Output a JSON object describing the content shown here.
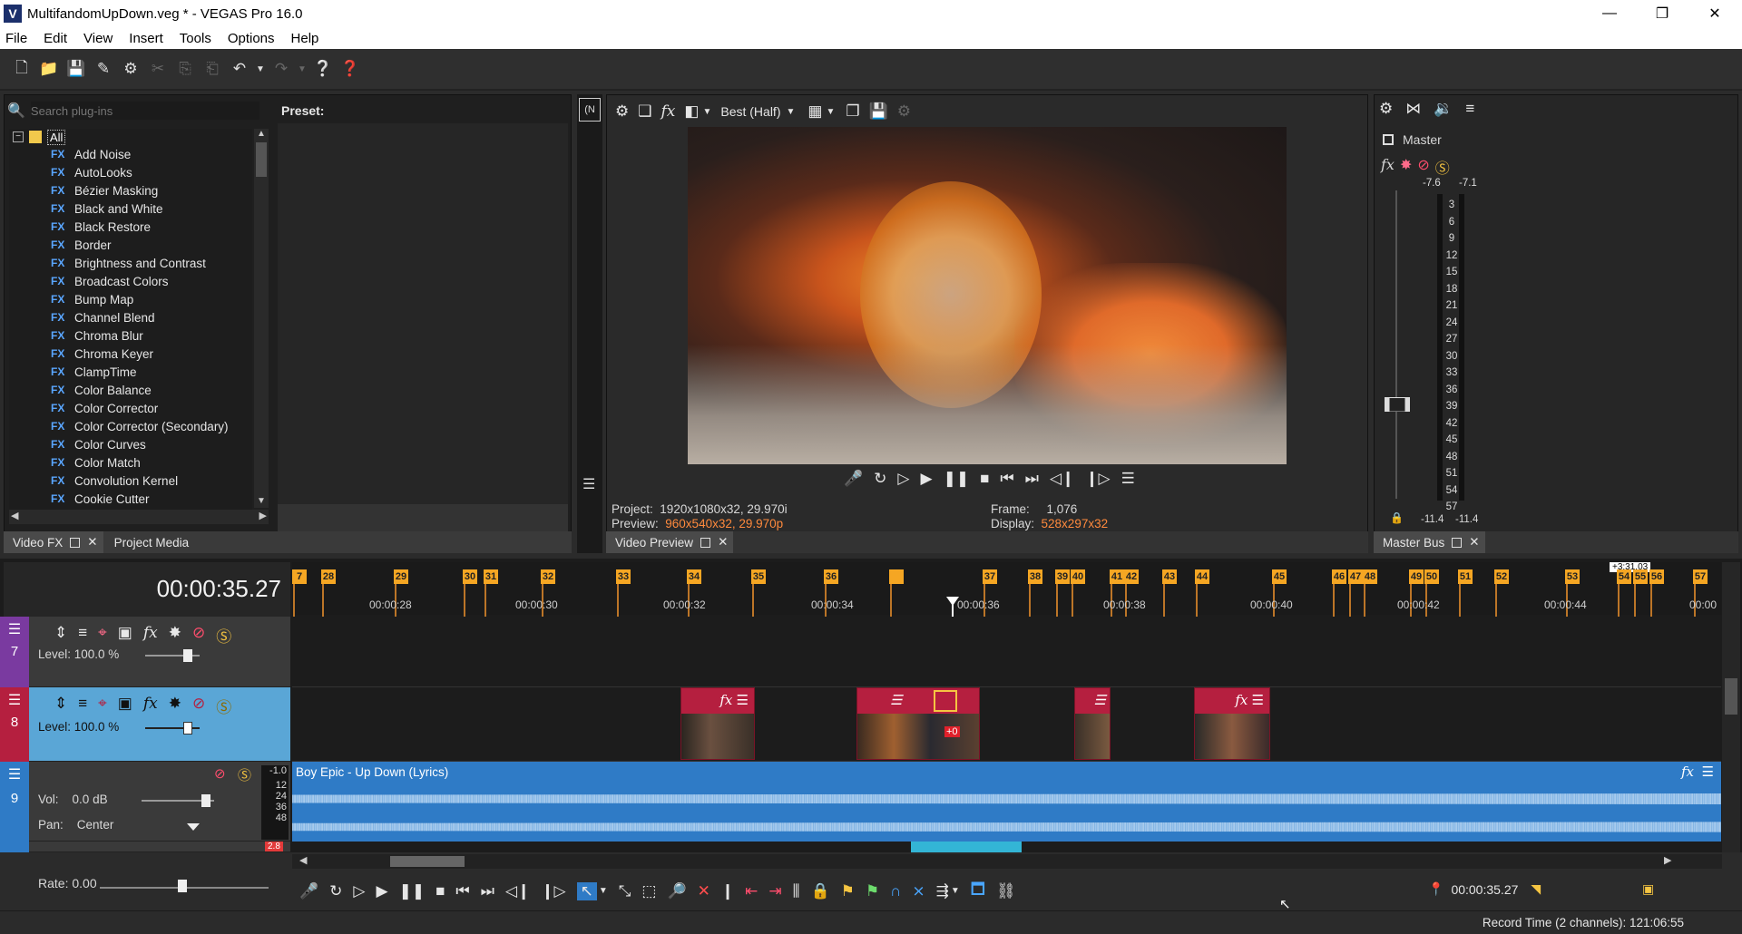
{
  "window": {
    "title": "MultifandomUpDown.veg * - VEGAS Pro 16.0",
    "app_icon": "V"
  },
  "menu": [
    "File",
    "Edit",
    "View",
    "Insert",
    "Tools",
    "Options",
    "Help"
  ],
  "plugins": {
    "search_placeholder": "Search plug-ins",
    "preset_label": "Preset:",
    "root": "All",
    "items": [
      "Add Noise",
      "AutoLooks",
      "Bézier Masking",
      "Black and White",
      "Black Restore",
      "Border",
      "Brightness and Contrast",
      "Broadcast Colors",
      "Bump Map",
      "Channel Blend",
      "Chroma Blur",
      "Chroma Keyer",
      "ClampTime",
      "Color Balance",
      "Color Corrector",
      "Color Corrector (Secondary)",
      "Color Curves",
      "Color Match",
      "Convolution Kernel",
      "Cookie Cutter"
    ],
    "fx_tag": "FX",
    "tab_video_fx": "Video FX",
    "tab_project_media": "Project Media"
  },
  "preview": {
    "quality": "Best (Half)",
    "project_label": "Project:",
    "project_value": "1920x1080x32, 29.970i",
    "preview_label": "Preview:",
    "preview_value": "960x540x32, 29.970p",
    "frame_label": "Frame:",
    "frame_value": "1,076",
    "display_label": "Display:",
    "display_value": "528x297x32",
    "tab": "Video Preview"
  },
  "master": {
    "label": "Master",
    "peak_l": "-7.6",
    "peak_r": "-7.1",
    "scale": [
      "3",
      "6",
      "9",
      "12",
      "15",
      "18",
      "21",
      "24",
      "27",
      "30",
      "33",
      "36",
      "39",
      "42",
      "45",
      "48",
      "51",
      "54",
      "57"
    ],
    "level_l": "-11.4",
    "level_r": "-11.4",
    "tab": "Master Bus"
  },
  "timeline": {
    "timecode": "00:00:35.27",
    "duration_badge": "+3:31.03",
    "markers": [
      "7",
      "28",
      "29",
      "30",
      "31",
      "32",
      "33",
      "34",
      "35",
      "36",
      "",
      "37",
      "38",
      "39",
      "40",
      "41",
      "42",
      "43",
      "44",
      "45",
      "46",
      "47",
      "48",
      "49",
      "50",
      "51",
      "52",
      "53",
      "54",
      "55",
      "56",
      "57"
    ],
    "ruler": [
      "00:00:28",
      "00:00:30",
      "00:00:32",
      "00:00:34",
      "00:00:36",
      "00:00:38",
      "00:00:40",
      "00:00:42",
      "00:00:44",
      "00:00"
    ],
    "tracks": [
      {
        "num": "7",
        "level": "Level: 100.0 %"
      },
      {
        "num": "8",
        "level": "Level: 100.0 %"
      },
      {
        "num": "9",
        "vol_label": "Vol:",
        "vol_value": "0.0 dB",
        "pan_label": "Pan:",
        "pan_value": "Center",
        "audio_clip": "Boy Epic - Up Down (Lyrics)",
        "meter_top": "-1.0",
        "meter_scale": [
          "12",
          "24",
          "36",
          "48"
        ],
        "next_meter": "2.8"
      }
    ],
    "clip_shift": "+0"
  },
  "transport": {
    "rate_label": "Rate:",
    "rate_value": "0.00",
    "cursor_time": "00:00:35.27"
  },
  "status": {
    "record_time": "Record Time (2 channels): 121:06:55"
  },
  "colors": {
    "accent_orange": "#f5a623",
    "clip_red": "#b51f3f",
    "audio_blue": "#2f7bc6",
    "track_header_blue": "#5aa6d6"
  }
}
